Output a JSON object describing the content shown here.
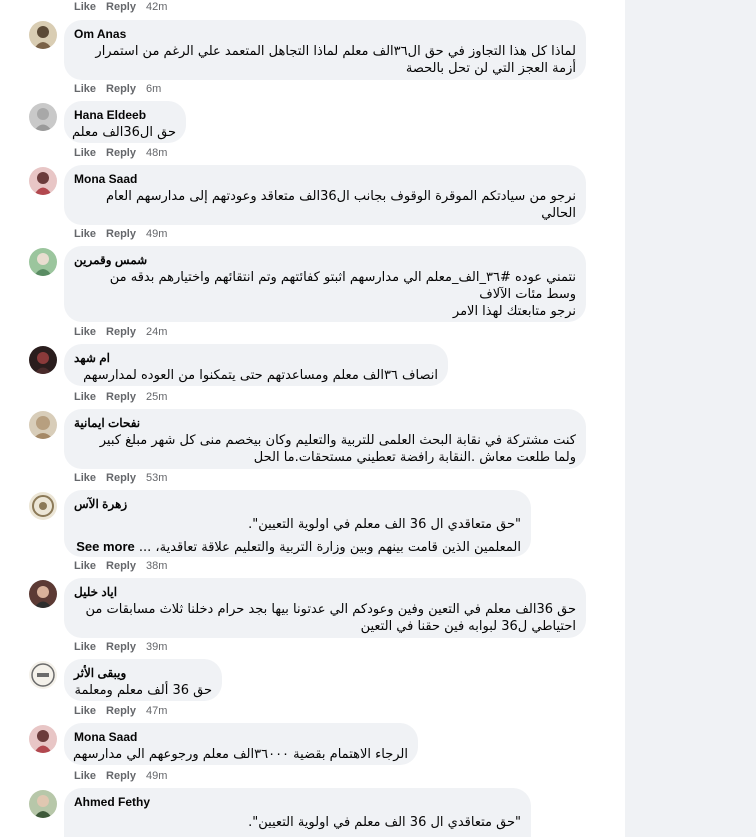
{
  "actions": {
    "like": "Like",
    "reply": "Reply",
    "see_more": "See more"
  },
  "top_row": {
    "time": "42m"
  },
  "comments": [
    {
      "author": "Om Anas",
      "lines": [
        "لماذا كل هذا التجاوز في حق ال٣٦الف معلم لماذا التجاهل المتعمد علي الرغم من استمرار",
        "أزمة العجز التي لن تحل بالحصة"
      ],
      "time": "6m"
    },
    {
      "author": "Hana Eldeeb",
      "lines": [
        "حق ال36الف معلم"
      ],
      "time": "48m"
    },
    {
      "author": "Mona Saad",
      "lines": [
        "نرجو من سيادتكم الموقرة الوقوف بجانب ال36الف متعاقد وعودتهم إلى مدارسهم العام",
        "الحالي"
      ],
      "time": "49m"
    },
    {
      "author": "شمس وقمرين",
      "lines": [
        "نتمني عوده #٣٦_الف_معلم الي مدارسهم اثبتو كفائتهم وتم انتقائهم واختيارهم بدقه من",
        "وسط مئات الآلاف",
        "نرجو متابعتك لهذا الامر"
      ],
      "time": "24m"
    },
    {
      "author": "ام شهد",
      "lines": [
        "انصاف ٣٦الف معلم ومساعدتهم حتى يتمكنوا من العوده لمدارسهم"
      ],
      "time": "25m"
    },
    {
      "author": "نفحات ايمانية",
      "lines": [
        "كنت مشتركة في نقابة البحث العلمى للتربية والتعليم وكان بيخصم منى كل شهر مبلغ كبير",
        "ولما طلعت معاش .النقابة رافضة تعطيني مستحقات.ما الحل"
      ],
      "time": "53m"
    },
    {
      "author": "زهرة الآس",
      "lines": [
        "\"حق متعاقدي ال 36 الف معلم في اولوية التعيين\".",
        "المعلمين الذين قامت بينهم وبين وزارة التربية والتعليم علاقة تعاقدية، ..."
      ],
      "time": "38m"
    },
    {
      "author": "اياد خليل",
      "lines": [
        "حق 36الف معلم في التعين وفين وعودكم الي عدتونا بيها بجد حرام دخلنا ثلاث مسابقات من",
        "احتياطي ل36 لبوابه فين حقنا في التعين"
      ],
      "time": "39m"
    },
    {
      "author": "ويبقى الأثر",
      "lines": [
        "حق 36 ألف معلم ومعلمة"
      ],
      "time": "47m"
    },
    {
      "author": "Mona Saad",
      "lines": [
        "الرجاء الاهتمام بقضية ٣٦٠٠٠الف معلم ورجوعهم الي مدارسهم"
      ],
      "time": "49m"
    },
    {
      "author": "Ahmed Fethy",
      "lines": [
        "\"حق متعاقدي ال 36 الف معلم في اولوية التعيين\"."
      ]
    }
  ]
}
